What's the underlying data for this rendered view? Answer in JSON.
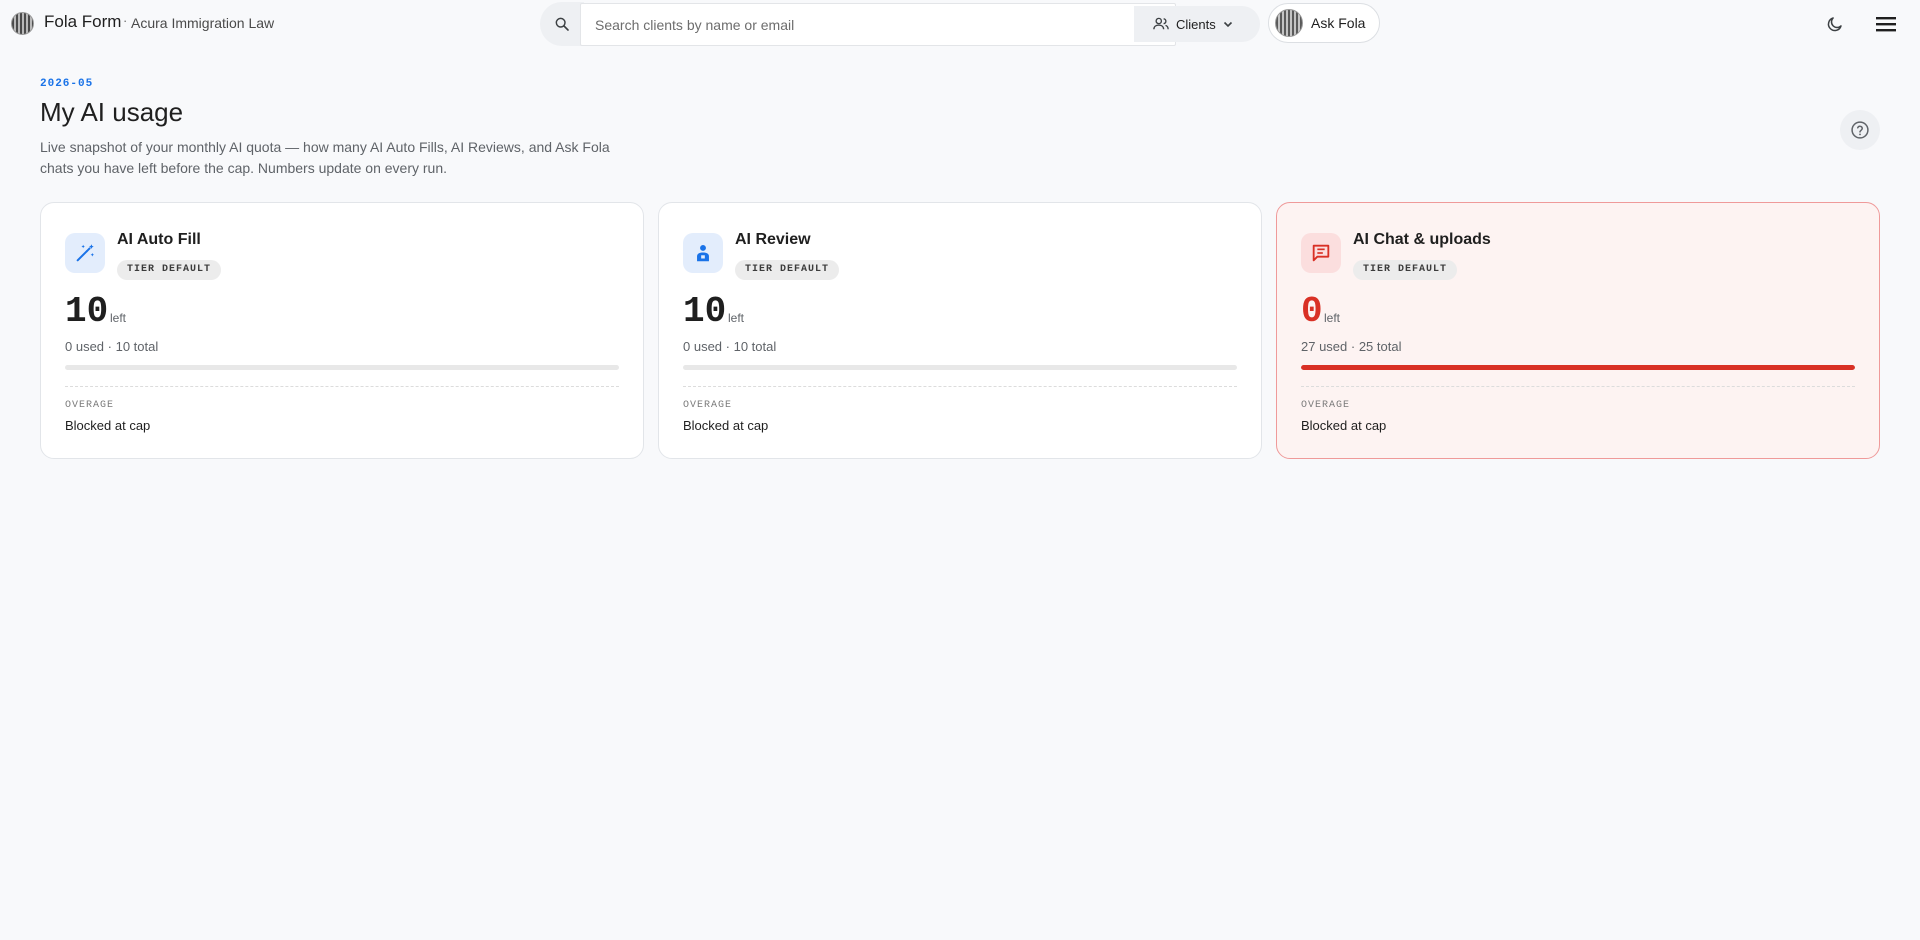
{
  "header": {
    "app_name": "Fola Form",
    "separator": "·",
    "org_name": "Acura Immigration Law",
    "search_placeholder": "Search clients by name or email",
    "search_value": "",
    "clients_label": "Clients",
    "ask_label": "Ask Fola",
    "icons": [
      "search-icon",
      "people-icon",
      "chevron-down-icon",
      "moon-icon",
      "hamburger-menu-icon"
    ]
  },
  "page": {
    "period": "2026-05",
    "title": "My AI usage",
    "description": "Live snapshot of your monthly AI quota — how many AI Auto Fills, AI Reviews, and Ask Fola chats you have left before the cap. Numbers update on every run."
  },
  "cards": [
    {
      "title": "AI Auto Fill",
      "icon": "magic-wand-icon",
      "badge": "TIER DEFAULT",
      "remaining": "10",
      "left_label": "left",
      "used_text": "0 used · 10 total",
      "progress": 0,
      "overage_label": "OVERAGE",
      "overage_value": "Blocked at cap"
    },
    {
      "title": "AI Review",
      "icon": "person-badge-icon",
      "badge": "TIER DEFAULT",
      "remaining": "10",
      "left_label": "left",
      "used_text": "0 used · 10 total",
      "progress": 0,
      "overage_label": "OVERAGE",
      "overage_value": "Blocked at cap"
    },
    {
      "title": "AI Chat & uploads",
      "icon": "chat-icon",
      "badge": "TIER DEFAULT",
      "remaining": "0",
      "left_label": "left",
      "used_text": "27 used · 25 total",
      "progress": 1,
      "overage_label": "OVERAGE",
      "overage_value": "Blocked at cap"
    }
  ],
  "colors": {
    "accent": "#1a73e8",
    "danger": "#d93025",
    "danger_bg": "#fdf3f2",
    "background": "#f8f9fb"
  }
}
